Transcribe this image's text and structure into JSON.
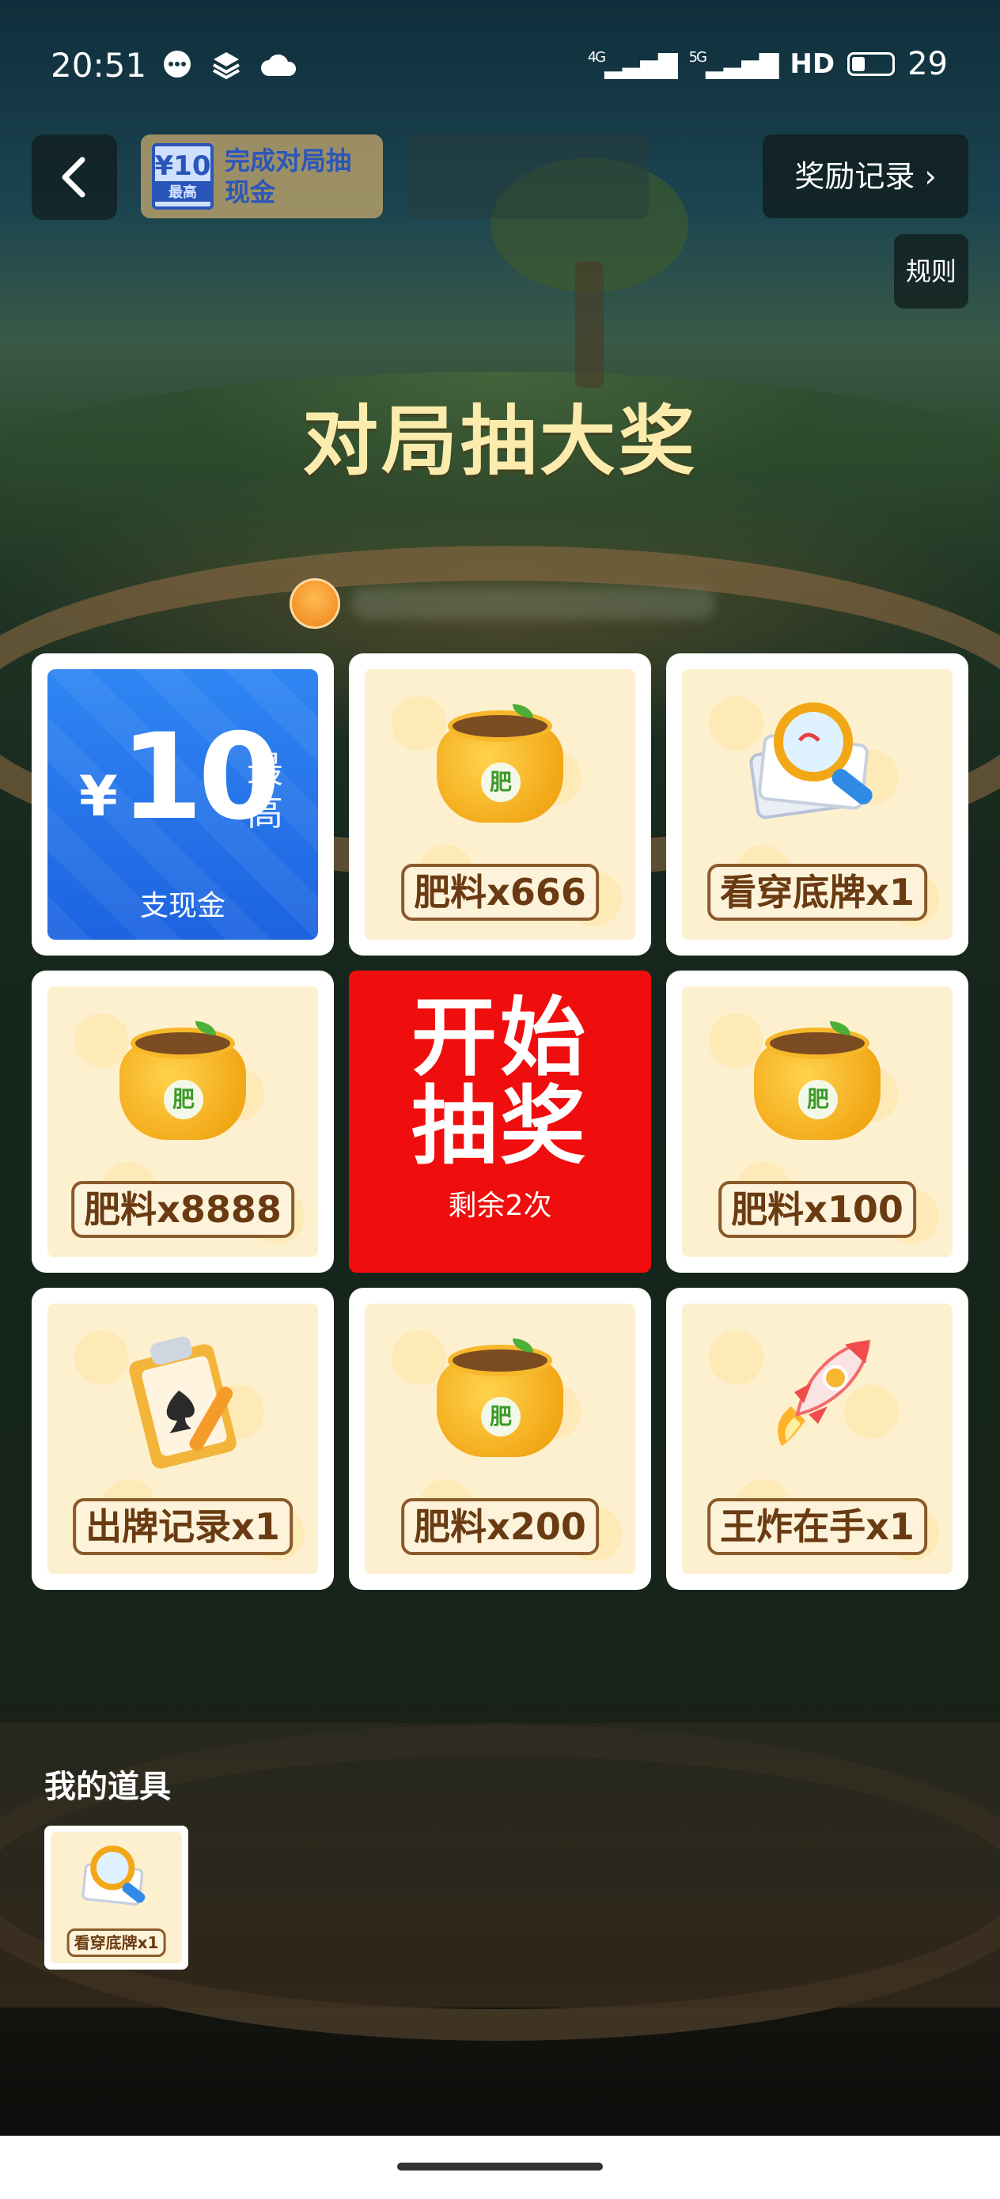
{
  "status_bar": {
    "time": "20:51",
    "left_icons": [
      "message-icon",
      "layers-icon",
      "cloud-icon"
    ],
    "signal_1": "4G",
    "signal_2": "5G",
    "hd_label": "HD",
    "battery_level": "29"
  },
  "nav": {
    "back_icon": "chevron-left-icon",
    "promo": {
      "badge_amount": "¥10",
      "badge_sub": "最高",
      "text": "完成对局抽现金"
    },
    "records_label": "奖励记录",
    "records_icon": "chevron-right-icon",
    "rules_label": "规则"
  },
  "title": "对局抽大奖",
  "grid": {
    "cash": {
      "currency": "¥",
      "amount": "10",
      "tag": "最高",
      "method": "支现金"
    },
    "items": [
      {
        "label": "肥料x666",
        "icon": "fertilizer-bag-icon"
      },
      {
        "label": "看穿底牌x1",
        "icon": "magnifier-cards-icon"
      },
      {
        "label": "肥料x8888",
        "icon": "fertilizer-bag-icon"
      },
      {
        "label": "肥料x100",
        "icon": "fertilizer-bag-icon"
      },
      {
        "label": "出牌记录x1",
        "icon": "clipboard-spade-icon"
      },
      {
        "label": "肥料x200",
        "icon": "fertilizer-bag-icon"
      },
      {
        "label": "王炸在手x1",
        "icon": "rocket-icon"
      }
    ],
    "fert_badge": "肥",
    "start": {
      "label": "开始抽奖",
      "remaining": "剩余2次"
    }
  },
  "props": {
    "title": "我的道具",
    "items": [
      {
        "label": "看穿底牌x1",
        "icon": "magnifier-cards-icon"
      }
    ]
  }
}
